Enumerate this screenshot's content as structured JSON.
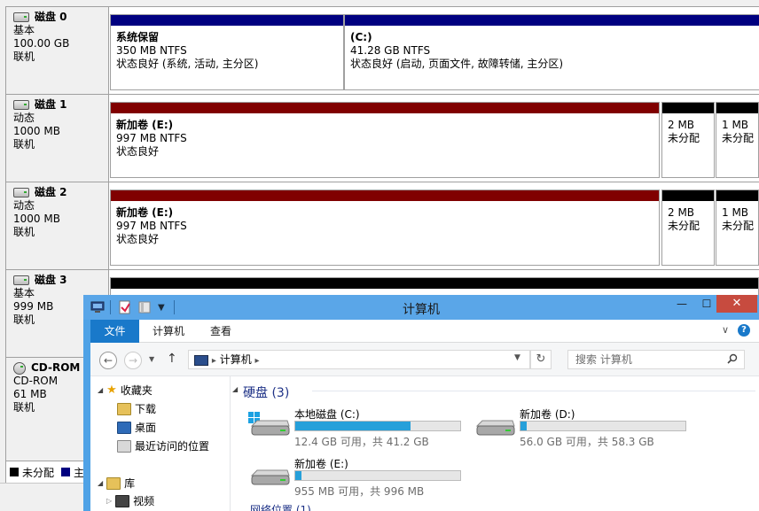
{
  "disk_mgmt": {
    "disks": [
      {
        "name": "磁盘 0",
        "type": "基本",
        "size": "100.00 GB",
        "status": "联机",
        "partitions": [
          {
            "title": "系统保留",
            "line2": "350 MB NTFS",
            "line3": "状态良好 (系统, 活动, 主分区)"
          },
          {
            "title": "(C:)",
            "line2": "41.28 GB NTFS",
            "line3": "状态良好 (启动, 页面文件, 故障转储, 主分区)"
          }
        ]
      },
      {
        "name": "磁盘 1",
        "type": "动态",
        "size": "1000 MB",
        "status": "联机",
        "partitions": [
          {
            "title": "新加卷 (E:)",
            "line2": "997 MB NTFS",
            "line3": "状态良好"
          },
          {
            "title": "",
            "line2": "2 MB",
            "line3": "未分配"
          },
          {
            "title": "",
            "line2": "1 MB",
            "line3": "未分配"
          }
        ]
      },
      {
        "name": "磁盘 2",
        "type": "动态",
        "size": "1000 MB",
        "status": "联机",
        "partitions": [
          {
            "title": "新加卷 (E:)",
            "line2": "997 MB NTFS",
            "line3": "状态良好"
          },
          {
            "title": "",
            "line2": "2 MB",
            "line3": "未分配"
          },
          {
            "title": "",
            "line2": "1 MB",
            "line3": "未分配"
          }
        ]
      },
      {
        "name": "磁盘 3",
        "type": "基本",
        "size": "999 MB",
        "status": "联机"
      },
      {
        "name": "CD-ROM",
        "type": "CD-ROM",
        "size": "61 MB",
        "status": "联机"
      }
    ],
    "legend": {
      "unallocated": "未分配",
      "primary": "主"
    },
    "colors": {
      "basic": "#000080",
      "dynamic": "#800000",
      "unallocated": "#000000"
    }
  },
  "explorer": {
    "title": "计算机",
    "ribbon_tabs": {
      "file": "文件",
      "computer": "计算机",
      "view": "查看"
    },
    "address": "计算机",
    "search_placeholder": "搜索 计算机",
    "nav": {
      "favorites": "收藏夹",
      "downloads": "下载",
      "desktop": "桌面",
      "recent": "最近访问的位置",
      "library": "库",
      "videos": "视频"
    },
    "group_header": "硬盘 (3)",
    "next_group": "网络位置 (1)",
    "drives": [
      {
        "name": "本地磁盘 (C:)",
        "free": "12.4 GB 可用，共 41.2 GB",
        "used_fraction": 0.7
      },
      {
        "name": "新加卷 (D:)",
        "free": "56.0 GB 可用，共 58.3 GB",
        "used_fraction": 0.04
      },
      {
        "name": "新加卷 (E:)",
        "free": "955 MB 可用，共 996 MB",
        "used_fraction": 0.04
      }
    ],
    "accent": "#1979ca",
    "title_bar_color": "#5aa6e8",
    "close_color": "#c74b3f"
  }
}
